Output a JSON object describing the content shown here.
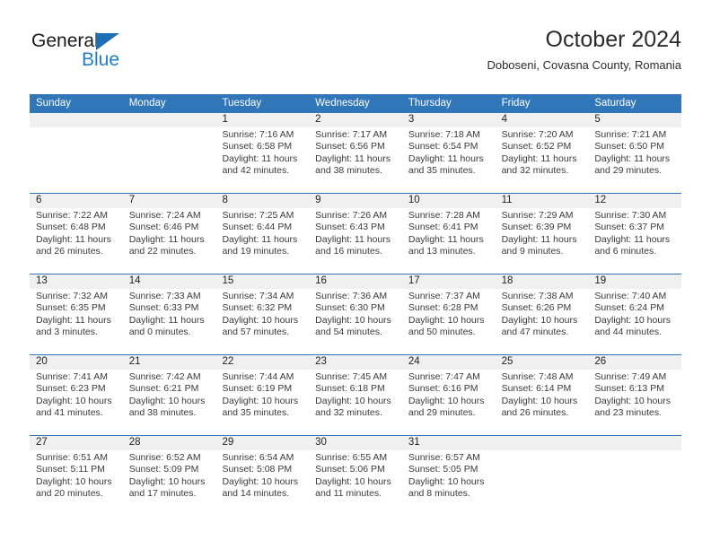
{
  "brand": {
    "name_top": "General",
    "name_bottom": "Blue",
    "triangle_color": "#1f6fb5",
    "blue_text_color": "#1f7ec4"
  },
  "header": {
    "title": "October 2024",
    "subtitle": "Doboseni, Covasna County, Romania"
  },
  "theme": {
    "header_blue": "#3176b8",
    "band_gray": "#f0f0f0",
    "text_dark": "#222222"
  },
  "weekdays": [
    "Sunday",
    "Monday",
    "Tuesday",
    "Wednesday",
    "Thursday",
    "Friday",
    "Saturday"
  ],
  "weeks": [
    {
      "days": [
        {
          "num": "",
          "sunrise": "",
          "sunset": "",
          "daylight_line1": "",
          "daylight_line2": ""
        },
        {
          "num": "",
          "sunrise": "",
          "sunset": "",
          "daylight_line1": "",
          "daylight_line2": ""
        },
        {
          "num": "1",
          "sunrise": "Sunrise: 7:16 AM",
          "sunset": "Sunset: 6:58 PM",
          "daylight_line1": "Daylight: 11 hours",
          "daylight_line2": "and 42 minutes."
        },
        {
          "num": "2",
          "sunrise": "Sunrise: 7:17 AM",
          "sunset": "Sunset: 6:56 PM",
          "daylight_line1": "Daylight: 11 hours",
          "daylight_line2": "and 38 minutes."
        },
        {
          "num": "3",
          "sunrise": "Sunrise: 7:18 AM",
          "sunset": "Sunset: 6:54 PM",
          "daylight_line1": "Daylight: 11 hours",
          "daylight_line2": "and 35 minutes."
        },
        {
          "num": "4",
          "sunrise": "Sunrise: 7:20 AM",
          "sunset": "Sunset: 6:52 PM",
          "daylight_line1": "Daylight: 11 hours",
          "daylight_line2": "and 32 minutes."
        },
        {
          "num": "5",
          "sunrise": "Sunrise: 7:21 AM",
          "sunset": "Sunset: 6:50 PM",
          "daylight_line1": "Daylight: 11 hours",
          "daylight_line2": "and 29 minutes."
        }
      ]
    },
    {
      "days": [
        {
          "num": "6",
          "sunrise": "Sunrise: 7:22 AM",
          "sunset": "Sunset: 6:48 PM",
          "daylight_line1": "Daylight: 11 hours",
          "daylight_line2": "and 26 minutes."
        },
        {
          "num": "7",
          "sunrise": "Sunrise: 7:24 AM",
          "sunset": "Sunset: 6:46 PM",
          "daylight_line1": "Daylight: 11 hours",
          "daylight_line2": "and 22 minutes."
        },
        {
          "num": "8",
          "sunrise": "Sunrise: 7:25 AM",
          "sunset": "Sunset: 6:44 PM",
          "daylight_line1": "Daylight: 11 hours",
          "daylight_line2": "and 19 minutes."
        },
        {
          "num": "9",
          "sunrise": "Sunrise: 7:26 AM",
          "sunset": "Sunset: 6:43 PM",
          "daylight_line1": "Daylight: 11 hours",
          "daylight_line2": "and 16 minutes."
        },
        {
          "num": "10",
          "sunrise": "Sunrise: 7:28 AM",
          "sunset": "Sunset: 6:41 PM",
          "daylight_line1": "Daylight: 11 hours",
          "daylight_line2": "and 13 minutes."
        },
        {
          "num": "11",
          "sunrise": "Sunrise: 7:29 AM",
          "sunset": "Sunset: 6:39 PM",
          "daylight_line1": "Daylight: 11 hours",
          "daylight_line2": "and 9 minutes."
        },
        {
          "num": "12",
          "sunrise": "Sunrise: 7:30 AM",
          "sunset": "Sunset: 6:37 PM",
          "daylight_line1": "Daylight: 11 hours",
          "daylight_line2": "and 6 minutes."
        }
      ]
    },
    {
      "days": [
        {
          "num": "13",
          "sunrise": "Sunrise: 7:32 AM",
          "sunset": "Sunset: 6:35 PM",
          "daylight_line1": "Daylight: 11 hours",
          "daylight_line2": "and 3 minutes."
        },
        {
          "num": "14",
          "sunrise": "Sunrise: 7:33 AM",
          "sunset": "Sunset: 6:33 PM",
          "daylight_line1": "Daylight: 11 hours",
          "daylight_line2": "and 0 minutes."
        },
        {
          "num": "15",
          "sunrise": "Sunrise: 7:34 AM",
          "sunset": "Sunset: 6:32 PM",
          "daylight_line1": "Daylight: 10 hours",
          "daylight_line2": "and 57 minutes."
        },
        {
          "num": "16",
          "sunrise": "Sunrise: 7:36 AM",
          "sunset": "Sunset: 6:30 PM",
          "daylight_line1": "Daylight: 10 hours",
          "daylight_line2": "and 54 minutes."
        },
        {
          "num": "17",
          "sunrise": "Sunrise: 7:37 AM",
          "sunset": "Sunset: 6:28 PM",
          "daylight_line1": "Daylight: 10 hours",
          "daylight_line2": "and 50 minutes."
        },
        {
          "num": "18",
          "sunrise": "Sunrise: 7:38 AM",
          "sunset": "Sunset: 6:26 PM",
          "daylight_line1": "Daylight: 10 hours",
          "daylight_line2": "and 47 minutes."
        },
        {
          "num": "19",
          "sunrise": "Sunrise: 7:40 AM",
          "sunset": "Sunset: 6:24 PM",
          "daylight_line1": "Daylight: 10 hours",
          "daylight_line2": "and 44 minutes."
        }
      ]
    },
    {
      "days": [
        {
          "num": "20",
          "sunrise": "Sunrise: 7:41 AM",
          "sunset": "Sunset: 6:23 PM",
          "daylight_line1": "Daylight: 10 hours",
          "daylight_line2": "and 41 minutes."
        },
        {
          "num": "21",
          "sunrise": "Sunrise: 7:42 AM",
          "sunset": "Sunset: 6:21 PM",
          "daylight_line1": "Daylight: 10 hours",
          "daylight_line2": "and 38 minutes."
        },
        {
          "num": "22",
          "sunrise": "Sunrise: 7:44 AM",
          "sunset": "Sunset: 6:19 PM",
          "daylight_line1": "Daylight: 10 hours",
          "daylight_line2": "and 35 minutes."
        },
        {
          "num": "23",
          "sunrise": "Sunrise: 7:45 AM",
          "sunset": "Sunset: 6:18 PM",
          "daylight_line1": "Daylight: 10 hours",
          "daylight_line2": "and 32 minutes."
        },
        {
          "num": "24",
          "sunrise": "Sunrise: 7:47 AM",
          "sunset": "Sunset: 6:16 PM",
          "daylight_line1": "Daylight: 10 hours",
          "daylight_line2": "and 29 minutes."
        },
        {
          "num": "25",
          "sunrise": "Sunrise: 7:48 AM",
          "sunset": "Sunset: 6:14 PM",
          "daylight_line1": "Daylight: 10 hours",
          "daylight_line2": "and 26 minutes."
        },
        {
          "num": "26",
          "sunrise": "Sunrise: 7:49 AM",
          "sunset": "Sunset: 6:13 PM",
          "daylight_line1": "Daylight: 10 hours",
          "daylight_line2": "and 23 minutes."
        }
      ]
    },
    {
      "days": [
        {
          "num": "27",
          "sunrise": "Sunrise: 6:51 AM",
          "sunset": "Sunset: 5:11 PM",
          "daylight_line1": "Daylight: 10 hours",
          "daylight_line2": "and 20 minutes."
        },
        {
          "num": "28",
          "sunrise": "Sunrise: 6:52 AM",
          "sunset": "Sunset: 5:09 PM",
          "daylight_line1": "Daylight: 10 hours",
          "daylight_line2": "and 17 minutes."
        },
        {
          "num": "29",
          "sunrise": "Sunrise: 6:54 AM",
          "sunset": "Sunset: 5:08 PM",
          "daylight_line1": "Daylight: 10 hours",
          "daylight_line2": "and 14 minutes."
        },
        {
          "num": "30",
          "sunrise": "Sunrise: 6:55 AM",
          "sunset": "Sunset: 5:06 PM",
          "daylight_line1": "Daylight: 10 hours",
          "daylight_line2": "and 11 minutes."
        },
        {
          "num": "31",
          "sunrise": "Sunrise: 6:57 AM",
          "sunset": "Sunset: 5:05 PM",
          "daylight_line1": "Daylight: 10 hours",
          "daylight_line2": "and 8 minutes."
        },
        {
          "num": "",
          "sunrise": "",
          "sunset": "",
          "daylight_line1": "",
          "daylight_line2": ""
        },
        {
          "num": "",
          "sunrise": "",
          "sunset": "",
          "daylight_line1": "",
          "daylight_line2": ""
        }
      ]
    }
  ]
}
